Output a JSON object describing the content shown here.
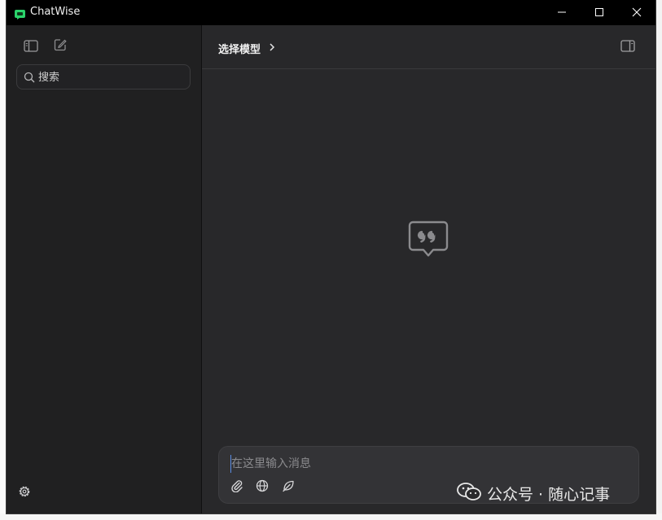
{
  "window": {
    "title": "ChatWise"
  },
  "sidebar": {
    "search": {
      "placeholder": "搜索",
      "value": ""
    }
  },
  "header": {
    "model_select_label": "选择模型"
  },
  "composer": {
    "placeholder": "在这里输入消息",
    "value": ""
  },
  "watermark": {
    "text": "公众号 · 随心记事"
  },
  "colors": {
    "titlebar_bg": "#000000",
    "sidebar_bg": "#202021",
    "main_bg": "#28282a",
    "composer_bg": "#333336",
    "app_icon_green": "#2bd36b"
  },
  "icons": {
    "app": "chatwise-logo-icon",
    "minimize": "minimize-icon",
    "maximize": "maximize-icon",
    "close": "close-icon",
    "sidebar_toggle": "sidebar-toggle-icon",
    "new_chat": "new-chat-icon",
    "search": "search-icon",
    "settings": "gear-icon",
    "chevron": "chevron-right-icon",
    "right_panel": "right-panel-toggle-icon",
    "empty_state": "quote-bubble-icon",
    "attach": "paperclip-icon",
    "web": "globe-icon",
    "leaf": "leaf-icon",
    "wechat": "wechat-icon"
  }
}
